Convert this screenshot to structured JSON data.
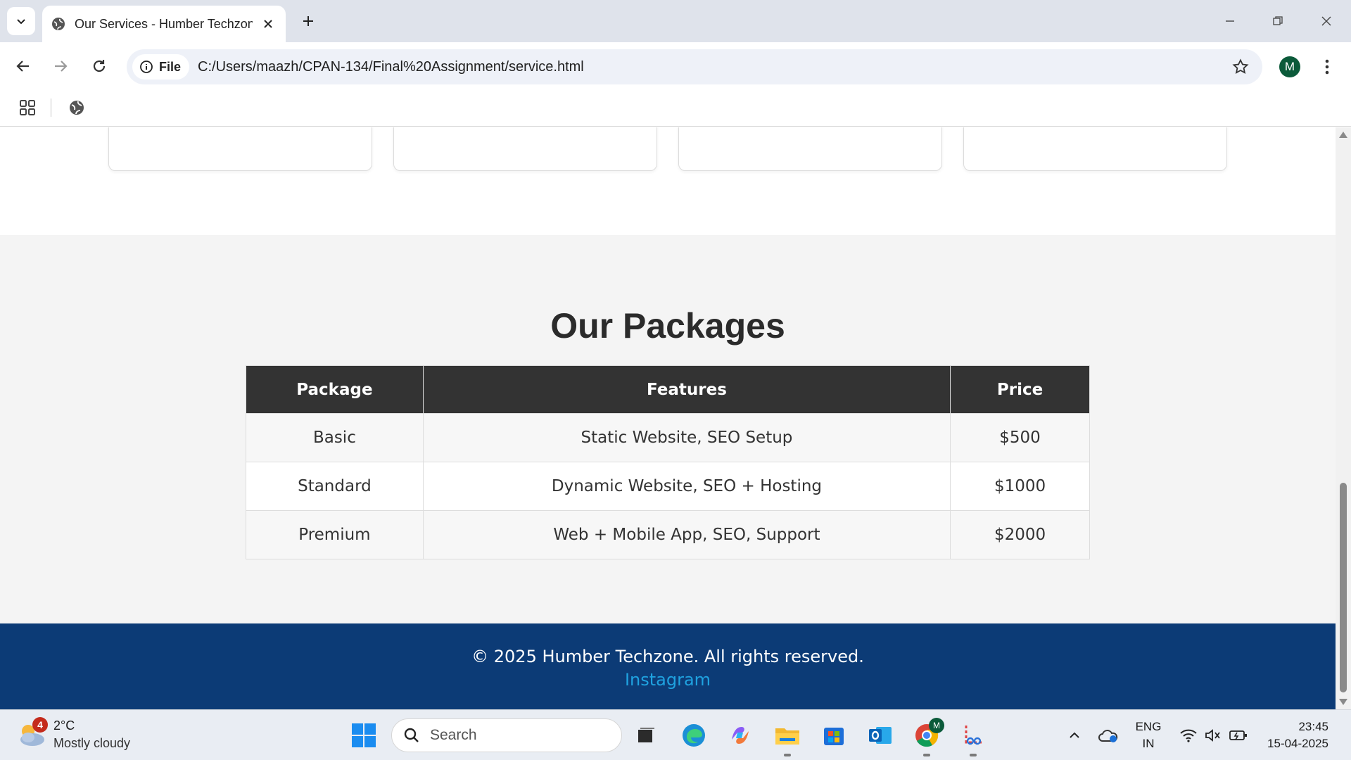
{
  "browser": {
    "tab_title": "Our Services - Humber Techzone",
    "chip_label": "File",
    "url": "C:/Users/maazh/CPAN-134/Final%20Assignment/service.html",
    "profile_initial": "M"
  },
  "packages": {
    "title": "Our Packages",
    "headers": [
      "Package",
      "Features",
      "Price"
    ],
    "rows": [
      {
        "package": "Basic",
        "features": "Static Website, SEO Setup",
        "price": "$500"
      },
      {
        "package": "Standard",
        "features": "Dynamic Website, SEO + Hosting",
        "price": "$1000"
      },
      {
        "package": "Premium",
        "features": "Web + Mobile App, SEO, Support",
        "price": "$2000"
      }
    ]
  },
  "footer": {
    "copyright": "© 2025 Humber Techzone. All rights reserved.",
    "instagram": "Instagram"
  },
  "taskbar": {
    "weather_badge": "4",
    "temperature": "2°C",
    "condition": "Mostly cloudy",
    "search_placeholder": "Search",
    "language_1": "ENG",
    "language_2": "IN",
    "time": "23:45",
    "date": "15-04-2025",
    "chrome_badge": "M"
  },
  "colors": {
    "footer_bg": "#0c3b76",
    "table_header_bg": "#333333",
    "link": "#1fa2e0"
  }
}
